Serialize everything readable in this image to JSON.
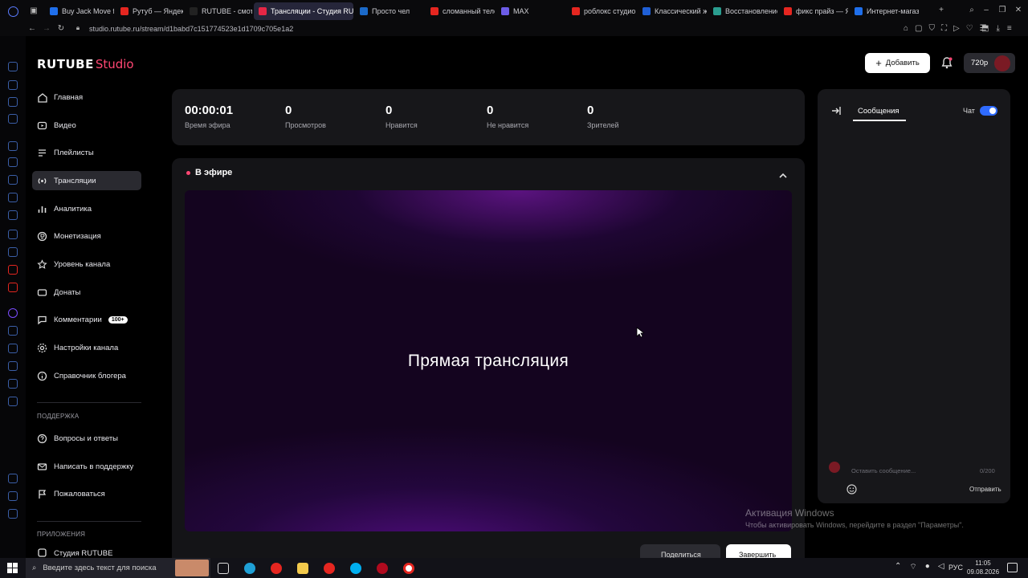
{
  "browser": {
    "tabs": [
      {
        "label": "Buy Jack Move f",
        "color": "#1f6feb"
      },
      {
        "label": "Рутуб — Яндекс",
        "color": "#e52620"
      },
      {
        "label": "RUTUBE - смотр",
        "color": "#222"
      },
      {
        "label": "Трансляции - Студия RUT",
        "color": "#e52645"
      },
      {
        "label": "Просто чел",
        "color": "#1b6ac9"
      },
      {
        "label": "сломанный теле",
        "color": "#e52620"
      },
      {
        "label": "MAX",
        "color": "#6c5ce7"
      },
      {
        "label": "роблокс студио",
        "color": "#e52620"
      },
      {
        "label": "Классический ж",
        "color": "#1f5fd6"
      },
      {
        "label": "Восстановление",
        "color": "#2a9d8f"
      },
      {
        "label": "фикс прайз — Я",
        "color": "#e52620"
      },
      {
        "label": "Интернет-магаз",
        "color": "#1f6feb"
      }
    ],
    "url": "studio.rutube.ru/stream/d1babd7c151774523e1d1709c705e1a2"
  },
  "brand": {
    "logo_main": "RUTUBE",
    "logo_sub": "Studio",
    "accent": "#ff4673"
  },
  "sidebar": {
    "items": [
      {
        "label": "Главная",
        "icon": "home-icon"
      },
      {
        "label": "Видео",
        "icon": "video-icon"
      },
      {
        "label": "Плейлисты",
        "icon": "playlist-icon"
      },
      {
        "label": "Трансляции",
        "icon": "broadcast-icon"
      },
      {
        "label": "Аналитика",
        "icon": "analytics-icon"
      },
      {
        "label": "Монетизация",
        "icon": "money-icon"
      },
      {
        "label": "Уровень канала",
        "icon": "level-icon"
      },
      {
        "label": "Донаты",
        "icon": "donate-icon"
      },
      {
        "label": "Комментарии",
        "icon": "comments-icon",
        "badge": "100+"
      },
      {
        "label": "Настройки канала",
        "icon": "settings-icon"
      },
      {
        "label": "Справочник блогера",
        "icon": "info-icon"
      }
    ],
    "support_title": "ПОДДЕРЖКА",
    "support_items": [
      {
        "label": "Вопросы и ответы",
        "icon": "question-icon"
      },
      {
        "label": "Написать в поддержку",
        "icon": "mail-icon"
      },
      {
        "label": "Пожаловаться",
        "icon": "flag-icon"
      }
    ],
    "apps_title": "ПРИЛОЖЕНИЯ",
    "apps_item": "Студия RUTUBE"
  },
  "header": {
    "add_label": "Добавить",
    "quality": "720p"
  },
  "stats": [
    {
      "value": "00:00:01",
      "label": "Время эфира"
    },
    {
      "value": "0",
      "label": "Просмотров"
    },
    {
      "value": "0",
      "label": "Нравится"
    },
    {
      "value": "0",
      "label": "Не нравится"
    },
    {
      "value": "0",
      "label": "Зрителей"
    }
  ],
  "live": {
    "status": "В эфире",
    "player_text": "Прямая трансляция",
    "btn_secondary": "Поделиться",
    "btn_primary": "Завершить"
  },
  "chat": {
    "tab": "Сообщения",
    "toggle_label": "Чат",
    "placeholder": "Оставить сообщение...",
    "counter": "0/200",
    "send": "Отправить"
  },
  "watermark": {
    "line1": "Активация Windows",
    "line2": "Чтобы активировать Windows, перейдите в раздел \"Параметры\"."
  },
  "taskbar": {
    "search_placeholder": "Введите здесь текст для поиска",
    "lang": "РУС",
    "time": "11:05",
    "date": "09.08.2026"
  }
}
